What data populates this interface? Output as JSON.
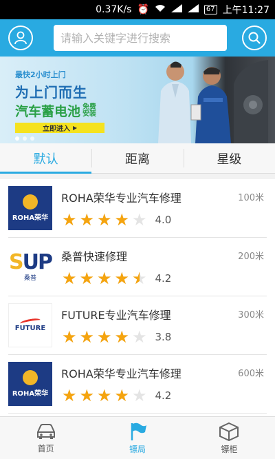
{
  "status_bar": {
    "speed": "0.37K/s",
    "battery": "67",
    "time": "上午11:27"
  },
  "header": {
    "search_placeholder": "请输入关键字进行搜索"
  },
  "banner": {
    "small": "最快2小时上门",
    "title1": "为上门而生",
    "title2": "汽车蓄电池",
    "free": "免费安装",
    "button": "立即进入"
  },
  "tabs": [
    {
      "label": "默认",
      "active": true
    },
    {
      "label": "距离",
      "active": false
    },
    {
      "label": "星级",
      "active": false
    }
  ],
  "shops": [
    {
      "name": "ROHA荣华专业汽车修理",
      "distance": "100米",
      "rating": 4.0,
      "score": "4.0",
      "logo": "roha",
      "logo_text": "ROHA荣华"
    },
    {
      "name": "桑普快速修理",
      "distance": "200米",
      "rating": 4.5,
      "score": "4.2",
      "logo": "sun",
      "logo_text": "SUP"
    },
    {
      "name": "FUTURE专业汽车修理",
      "distance": "300米",
      "rating": 4.0,
      "score": "3.8",
      "logo": "future",
      "logo_text": "FUTURE"
    },
    {
      "name": "ROHA荣华专业汽车修理",
      "distance": "600米",
      "rating": 4.0,
      "score": "4.2",
      "logo": "roha",
      "logo_text": "ROHA荣华"
    }
  ],
  "bottom_nav": [
    {
      "label": "首页",
      "icon": "car-icon",
      "active": false
    },
    {
      "label": "镖局",
      "icon": "flag-icon",
      "active": true
    },
    {
      "label": "镖柜",
      "icon": "box-icon",
      "active": false
    }
  ],
  "colors": {
    "accent": "#29aae1",
    "star": "#f5a40f"
  }
}
